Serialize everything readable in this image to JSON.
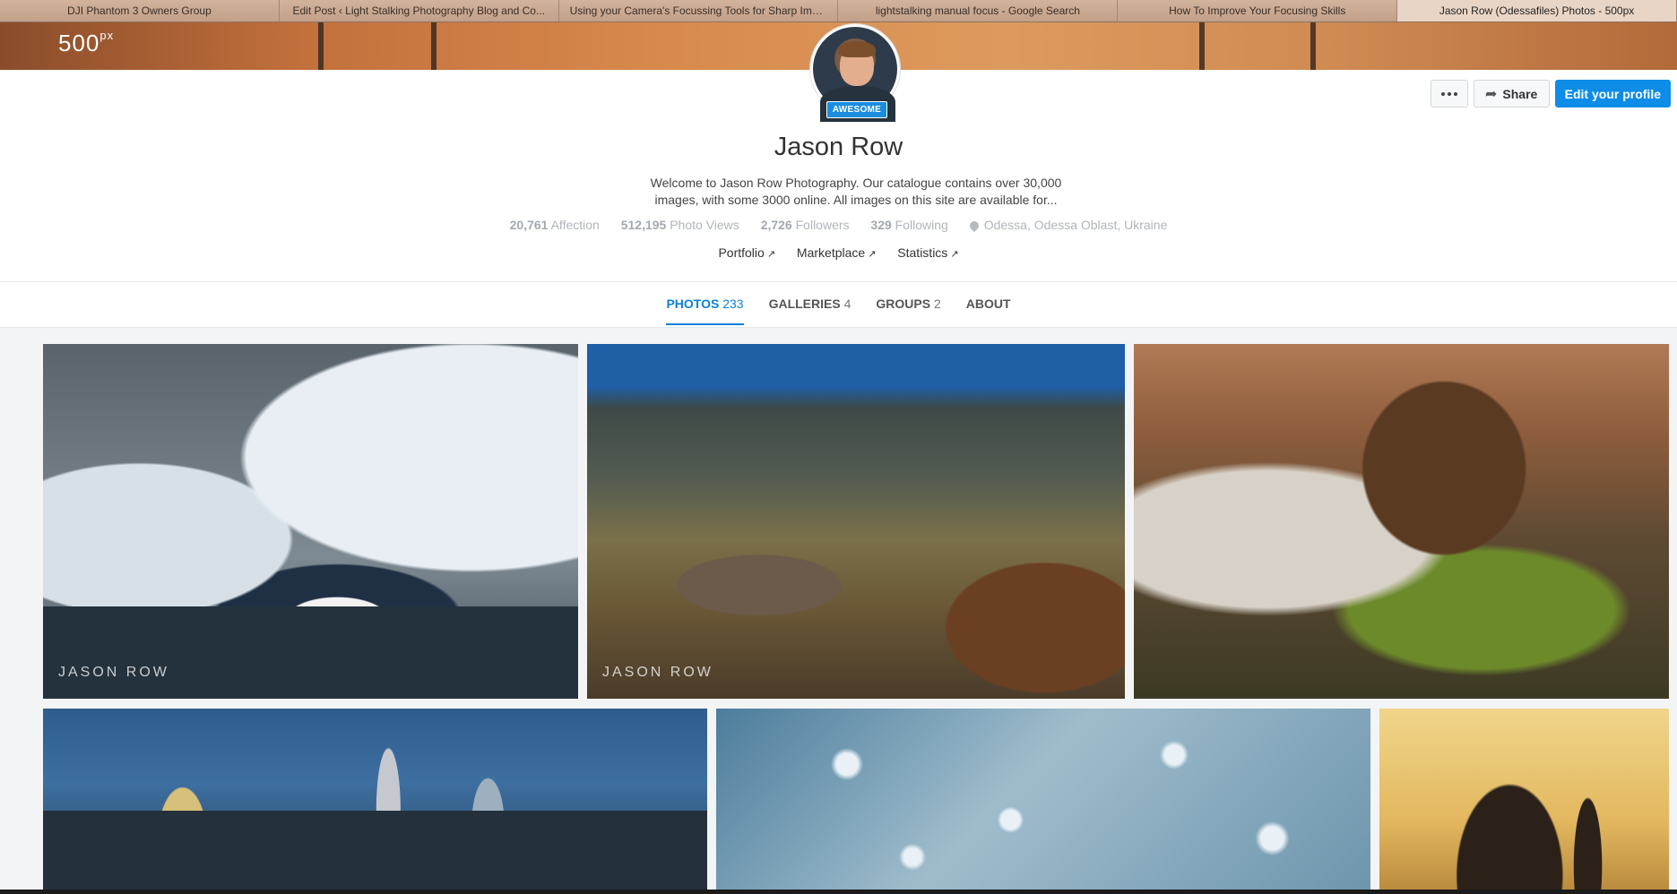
{
  "browser": {
    "tabs": [
      {
        "title": "DJI Phantom 3 Owners Group",
        "active": false
      },
      {
        "title": "Edit Post ‹ Light Stalking Photography Blog and Co...",
        "active": false
      },
      {
        "title": "Using your Camera's Focussing Tools for Sharp Ima...",
        "active": false
      },
      {
        "title": "lightstalking manual focus - Google Search",
        "active": false
      },
      {
        "title": "How To Improve Your Focusing Skills",
        "active": false
      },
      {
        "title": "Jason Row (Odessafiles) Photos - 500px",
        "active": true
      }
    ]
  },
  "site": {
    "logo_main": "500",
    "logo_sup": "px"
  },
  "profile": {
    "badge": "AWESOME",
    "name": "Jason Row",
    "bio": "Welcome to Jason Row Photography. Our catalogue contains over 30,000 images, with some 3000 online. All images on this site are available for...",
    "stats": [
      {
        "value": "20,761",
        "label": "Affection"
      },
      {
        "value": "512,195",
        "label": "Photo Views"
      },
      {
        "value": "2,726",
        "label": "Followers"
      },
      {
        "value": "329",
        "label": "Following"
      }
    ],
    "location": "Odessa, Odessa Oblast, Ukraine",
    "links": [
      "Portfolio",
      "Marketplace",
      "Statistics"
    ]
  },
  "actions": {
    "share": "Share",
    "edit": "Edit your profile"
  },
  "nav": [
    {
      "label": "PHOTOS",
      "count": "233",
      "active": true
    },
    {
      "label": "GALLERIES",
      "count": "4",
      "active": false
    },
    {
      "label": "GROUPS",
      "count": "2",
      "active": false
    },
    {
      "label": "ABOUT",
      "count": "",
      "active": false
    }
  ],
  "photos": {
    "watermark": "JASON ROW"
  },
  "colors": {
    "accent": "#0d8de8",
    "badge": "#1a8de0"
  }
}
